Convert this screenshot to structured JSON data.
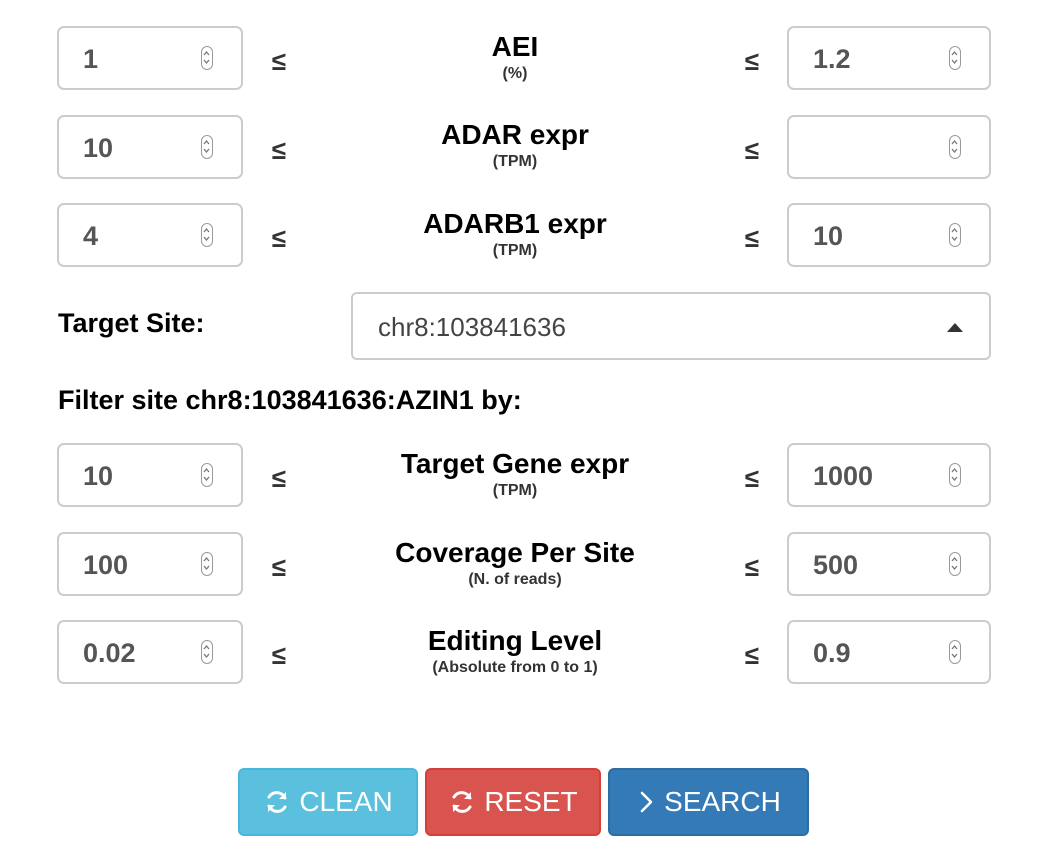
{
  "filters": {
    "aei": {
      "min": "1",
      "max": "1.2",
      "label": "AEI",
      "unit": "(%)"
    },
    "adar": {
      "min": "10",
      "max": "",
      "label": "ADAR expr",
      "unit": "(TPM)"
    },
    "adarb1": {
      "min": "4",
      "max": "10",
      "label": "ADARB1 expr",
      "unit": "(TPM)"
    }
  },
  "leq_symbol": "≤",
  "target_site": {
    "label": "Target Site:",
    "value": "chr8:103841636"
  },
  "site_filter": {
    "heading": "Filter site chr8:103841636:AZIN1 by:",
    "gene_expr": {
      "min": "10",
      "max": "1000",
      "label": "Target Gene expr",
      "unit": "(TPM)"
    },
    "coverage": {
      "min": "100",
      "max": "500",
      "label": "Coverage Per Site",
      "unit": "(N. of reads)"
    },
    "editing": {
      "min": "0.02",
      "max": "0.9",
      "label": "Editing Level",
      "unit": "(Absolute from 0 to 1)"
    }
  },
  "buttons": {
    "clean": "CLEAN",
    "reset": "RESET",
    "search": "SEARCH"
  },
  "colors": {
    "clean": "#5bc0de",
    "reset": "#d9534f",
    "search": "#337ab7",
    "input_border": "#cccccc",
    "input_text": "#555555"
  },
  "icons": {
    "spinner": "up-down-spinner-icon",
    "clean": "refresh-icon",
    "reset": "refresh-icon",
    "search": "chevron-right-icon",
    "select": "caret-up-icon"
  }
}
